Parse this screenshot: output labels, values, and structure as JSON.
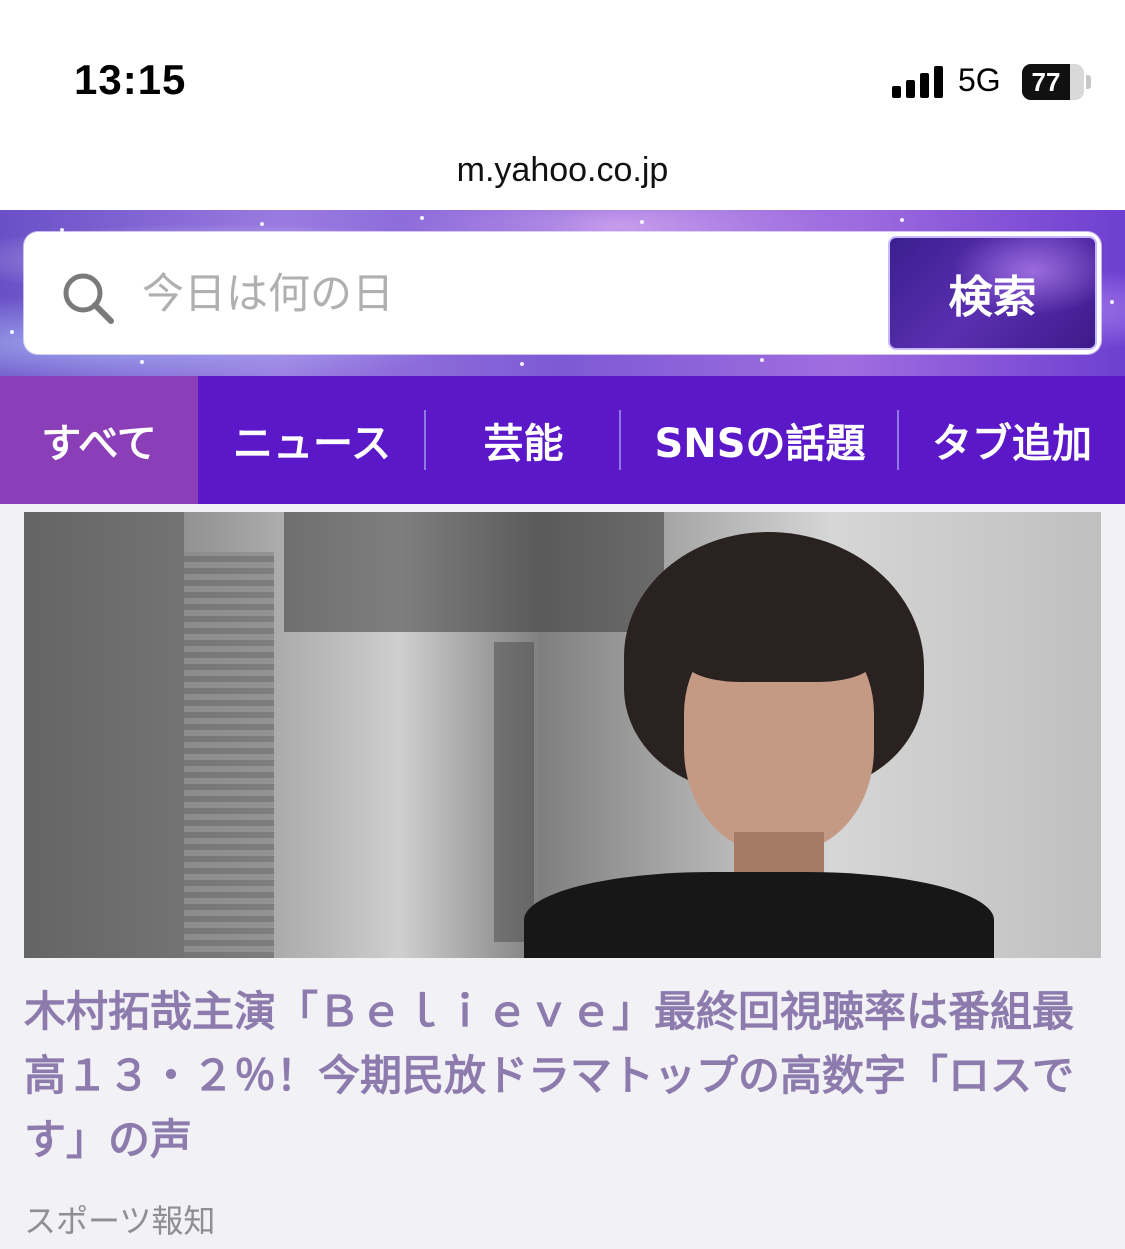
{
  "status_bar": {
    "time": "13:15",
    "network": "5G",
    "battery": "77",
    "battery_level": 0.77
  },
  "browser": {
    "url": "m.yahoo.co.jp"
  },
  "search": {
    "placeholder": "今日は何の日",
    "button_label": "検索",
    "icon": "search-icon"
  },
  "tabs": [
    {
      "label": "すべて",
      "active": true
    },
    {
      "label": "ニュース",
      "active": false
    },
    {
      "label": "芸能",
      "active": false
    },
    {
      "label": "SNSの話題",
      "active": false
    },
    {
      "label": "タブ追加",
      "active": false
    }
  ],
  "article": {
    "headline": "木村拓哉主演「Ｂｅｌｉｅｖｅ」最終回視聴率は番組最高１３・２％！今期民放ドラマトップの高数字「ロスです」の声",
    "source": "スポーツ報知"
  },
  "colors": {
    "tab_bar": "#5a18c8",
    "tab_active": "#8a3fb8",
    "headline": "#8d7bad"
  }
}
